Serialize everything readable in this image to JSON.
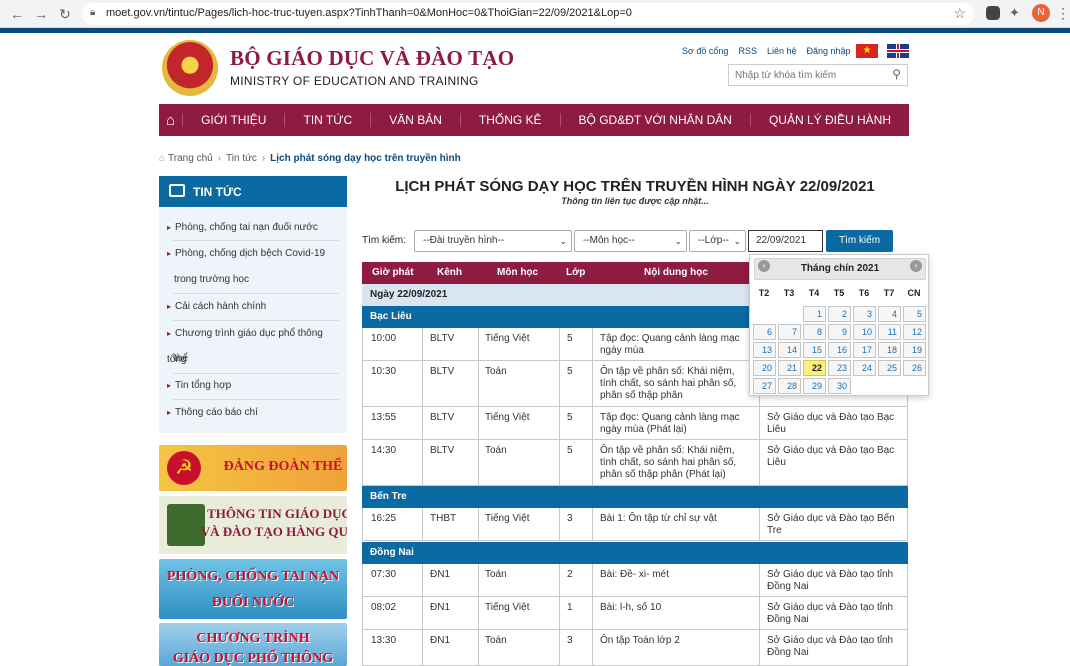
{
  "browser": {
    "url": "moet.gov.vn/tintuc/Pages/lich-hoc-truc-tuyen.aspx?TinhThanh=0&MonHoc=0&ThoiGian=22/09/2021&Lop=0",
    "profile_initial": "N"
  },
  "header": {
    "org_vn": "BỘ GIÁO DỤC VÀ ĐÀO TẠO",
    "org_en": "MINISTRY OF EDUCATION AND TRAINING",
    "links": [
      "Sơ đồ cổng",
      "RSS",
      "Liên hệ",
      "Đăng nhập"
    ],
    "search_placeholder": "Nhập từ khóa tìm kiếm"
  },
  "nav": [
    "GIỚI THIỆU",
    "TIN TỨC",
    "VĂN BẢN",
    "THỐNG KÊ",
    "BỘ GD&ĐT VỚI NHÂN DÂN",
    "QUẢN LÝ ĐIỀU HÀNH"
  ],
  "breadcrumb": [
    "Trang chủ",
    "Tin tức",
    "Lịch phát sóng dạy học trên truyền hình"
  ],
  "sidebar": {
    "title": "TIN TỨC",
    "items": [
      "Phòng, chống tai nạn đuối nước",
      "Phòng, chống dịch bệch Covid-19",
      "trong trường học",
      "Cải cách hành chính",
      "Chương trình giáo dục phổ thông tổng",
      "thể",
      "Tin tổng hợp",
      "Thông cáo báo chí"
    ],
    "banners": [
      "ĐẢNG ĐOÀN THỂ",
      "THÔNG TIN GIÁO DỤC",
      "VÀ ĐÀO TẠO HÀNG QUÝ",
      "PHÒNG, CHỐNG TAI NẠN",
      "ĐUỐI NƯỚC",
      "CHƯƠNG TRÌNH",
      "GIÁO DỤC PHỔ THÔNG MỚI"
    ]
  },
  "main": {
    "title": "LỊCH PHÁT SÓNG DẠY HỌC TRÊN TRUYỀN HÌNH NGÀY 22/09/2021",
    "subtitle": "Thông tin liên tục được cập nhật...",
    "search_label": "Tìm kiếm:",
    "station_select": "--Đài truyền hình--",
    "subject_select": "--Môn học--",
    "grade_select": "--Lớp--",
    "date_value": "22/09/2021",
    "search_button": "Tìm kiếm"
  },
  "table": {
    "headers": [
      "Giờ phát",
      "Kênh",
      "Môn học",
      "Lớp",
      "Nội dung học"
    ],
    "date_label": "Ngày 22/09/2021",
    "provinces": [
      "Bạc Liêu",
      "Bến Tre",
      "Đồng Nai"
    ],
    "rows": [
      {
        "time": "10:00",
        "channel": "BLTV",
        "subject": "Tiếng Việt",
        "grade": "5",
        "content": [
          "Tập đọc: Quang cảnh làng mạc",
          "ngày mùa"
        ],
        "source": [
          "",
          ""
        ]
      },
      {
        "time": "10:30",
        "channel": "BLTV",
        "subject": "Toán",
        "grade": "5",
        "content": [
          "Ôn tập về phân số: Khái niệm,",
          "tính chất, so sánh hai phân số,",
          "phân số thập phân"
        ],
        "source": [
          "",
          ""
        ]
      },
      {
        "time": "13:55",
        "channel": "BLTV",
        "subject": "Tiếng Việt",
        "grade": "5",
        "content": [
          "Tập đọc: Quang cảnh làng mạc",
          "ngày mùa (Phát lại)"
        ],
        "source": [
          "Sở Giáo dục và Đào tạo Bạc",
          "Liêu"
        ]
      },
      {
        "time": "14:30",
        "channel": "BLTV",
        "subject": "Toán",
        "grade": "5",
        "content": [
          "Ôn tập về phân số: Khái niệm,",
          "tính chất, so sánh hai phân số,",
          "phân số thập phân (Phát lại)"
        ],
        "source": [
          "Sở Giáo dục và Đào tạo Bạc",
          "Liêu"
        ]
      },
      {
        "time": "16:25",
        "channel": "THBT",
        "subject": "Tiếng Việt",
        "grade": "3",
        "content": [
          "Bài 1: Ôn tập từ chỉ sự vật",
          ""
        ],
        "source": [
          "Sở Giáo dục và Đào tạo Bến",
          "Tre"
        ]
      },
      {
        "time": "07:30",
        "channel": "ĐN1",
        "subject": "Toán",
        "grade": "2",
        "content": [
          "Bài: Đề- xi- mét",
          ""
        ],
        "source": [
          "Sở Giáo dục và Đào tạo tỉnh",
          "Đồng Nai"
        ]
      },
      {
        "time": "08:02",
        "channel": "ĐN1",
        "subject": "Tiếng Việt",
        "grade": "1",
        "content": [
          "Bài: l-h, số 10",
          ""
        ],
        "source": [
          "Sở Giáo dục và Đào tạo tỉnh",
          "Đồng Nai"
        ]
      },
      {
        "time": "13:30",
        "channel": "ĐN1",
        "subject": "Toán",
        "grade": "3",
        "content": [
          "Ôn tập Toán lớp 2",
          ""
        ],
        "source": [
          "Sở Giáo dục và Đào tạo tỉnh",
          "Đồng Nai"
        ]
      }
    ]
  },
  "calendar": {
    "month_label": "Tháng chín 2021",
    "weekdays": [
      "T2",
      "T3",
      "T4",
      "T5",
      "T6",
      "T7",
      "CN"
    ],
    "first_weekday_index": 2,
    "days_in_month": 30,
    "selected_day": 22
  },
  "colors": {
    "brand": "#8e1b40",
    "accent": "#0b6aa2"
  }
}
